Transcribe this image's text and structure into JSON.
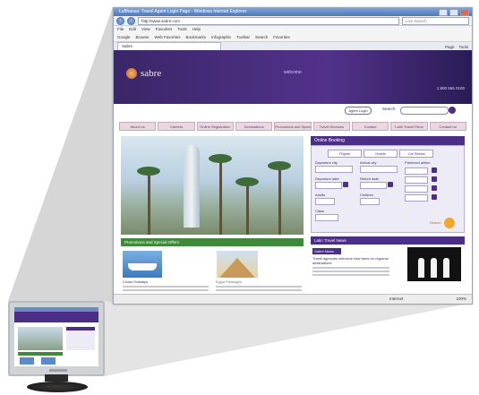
{
  "browser": {
    "title": "Lufthansa: Travel Agent Login Page - Windows Internet Explorer",
    "address": "http://www.sabre.com",
    "search_placeholder": "Live Search",
    "menu": [
      "File",
      "Edit",
      "View",
      "Favorites",
      "Tools",
      "Help"
    ],
    "links": [
      "Google",
      "Browse",
      "Web Favorites",
      "Bookmarks",
      "Infographic",
      "Toolbar",
      "Search",
      "Favorites"
    ],
    "tab_label": "Sabre",
    "tab_tools": [
      "Page",
      "Tools"
    ],
    "status_text": "Internet",
    "zoom": "100%"
  },
  "site": {
    "logo_text": "sabre",
    "tagline": "welcome",
    "phone": "1 800 555 0100",
    "login_label": "Agent Login",
    "search_label": "Search",
    "nav": [
      "About Us",
      "Careers",
      "Online Registration",
      "Destinations",
      "Promotions and Special Offers",
      "Travel Services",
      "Contact",
      "Latin Travel Films",
      "Contact Us"
    ],
    "promo_heading": "Promotions and Special Offers",
    "promo1_caption": "Cruise Holidays",
    "promo2_caption": "Egypt Packages",
    "booking": {
      "heading": "Online Booking",
      "tabs": [
        "Flights",
        "Hotels",
        "Car Rental"
      ],
      "fields": [
        "Departure city",
        "Arrival city",
        "Departure date",
        "Return date",
        "Adults",
        "Children",
        "Class",
        "Preferred airline"
      ],
      "search_label": "Search"
    },
    "news": {
      "heading": "Latin Travel News",
      "tag": "Sabre News",
      "title": "Travel agencies welcome new fares for regional destinations"
    }
  }
}
